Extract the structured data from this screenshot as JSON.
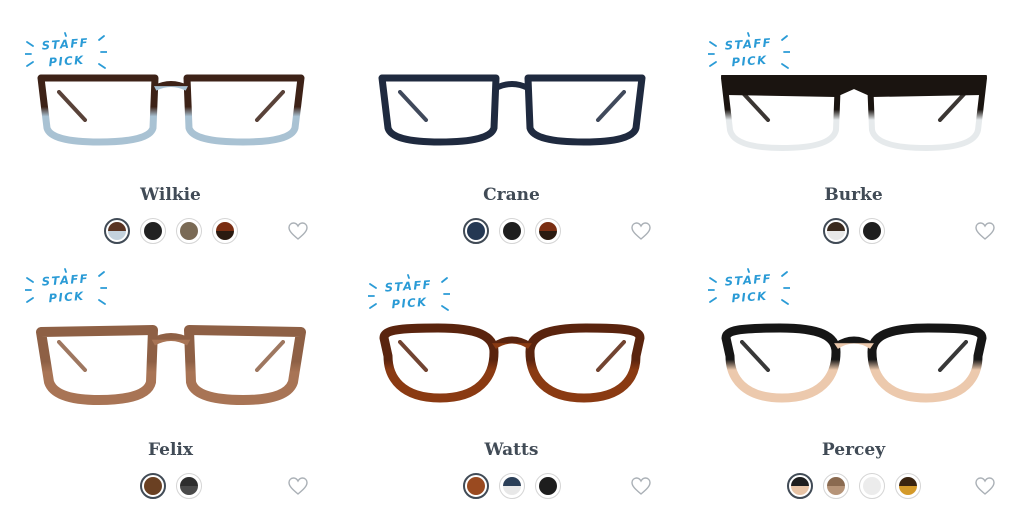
{
  "badge": {
    "line1": "STAFF",
    "line2": "PICK",
    "color": "#2a9bd6"
  },
  "heart_icon": "heart-icon",
  "products": [
    {
      "name": "Wilkie",
      "staff_pick": true,
      "style": "rect",
      "frame_top": "#3d2217",
      "frame_bottom": "#a9c2d3",
      "swatches": [
        {
          "top": "#5a3422",
          "bottom": "#c4d2dd",
          "active": true
        },
        {
          "top": "#222222",
          "bottom": "#222222",
          "active": false
        },
        {
          "top": "#7a6a55",
          "bottom": "#7a6a55",
          "active": false
        },
        {
          "top": "#7a2e12",
          "bottom": "#2a1a10",
          "active": false
        }
      ]
    },
    {
      "name": "Crane",
      "staff_pick": false,
      "style": "rect",
      "frame_top": "#1f2a3f",
      "frame_bottom": "#1f2a3f",
      "swatches": [
        {
          "top": "#243853",
          "bottom": "#243853",
          "active": true
        },
        {
          "top": "#1e1e1e",
          "bottom": "#1e1e1e",
          "active": false
        },
        {
          "top": "#7a2e12",
          "bottom": "#2a1a10",
          "active": false
        }
      ]
    },
    {
      "name": "Burke",
      "staff_pick": true,
      "style": "browline",
      "frame_top": "#1a1410",
      "frame_bottom": "#e6eaec",
      "swatches": [
        {
          "top": "#3a2a1e",
          "bottom": "#e8e8e8",
          "active": true
        },
        {
          "top": "#1e1e1e",
          "bottom": "#1e1e1e",
          "active": false
        }
      ]
    },
    {
      "name": "Felix",
      "staff_pick": true,
      "style": "square",
      "frame_top": "#8e6045",
      "frame_bottom": "#a87455",
      "swatches": [
        {
          "top": "#6a4022",
          "bottom": "#6a4022",
          "active": true
        },
        {
          "top": "#2e2e2e",
          "bottom": "#4a4a4a",
          "active": false
        }
      ]
    },
    {
      "name": "Watts",
      "staff_pick": true,
      "style": "round",
      "frame_top": "#5a240e",
      "frame_bottom": "#8a3a12",
      "swatches": [
        {
          "top": "#9a4a20",
          "bottom": "#9a4a20",
          "active": true
        },
        {
          "top": "#2b3f58",
          "bottom": "#e8e8e8",
          "active": false
        },
        {
          "top": "#1e1e1e",
          "bottom": "#1e1e1e",
          "active": false
        }
      ]
    },
    {
      "name": "Percey",
      "staff_pick": true,
      "style": "round",
      "frame_top": "#161616",
      "frame_bottom": "#ecc9ad",
      "swatches": [
        {
          "top": "#1e1e1e",
          "bottom": "#e8c4a6",
          "active": true
        },
        {
          "top": "#8a6a50",
          "bottom": "#b69478",
          "active": false
        },
        {
          "top": "#ececec",
          "bottom": "#ececec",
          "active": false
        },
        {
          "top": "#3a2410",
          "bottom": "#d49a2a",
          "active": false
        }
      ]
    }
  ]
}
